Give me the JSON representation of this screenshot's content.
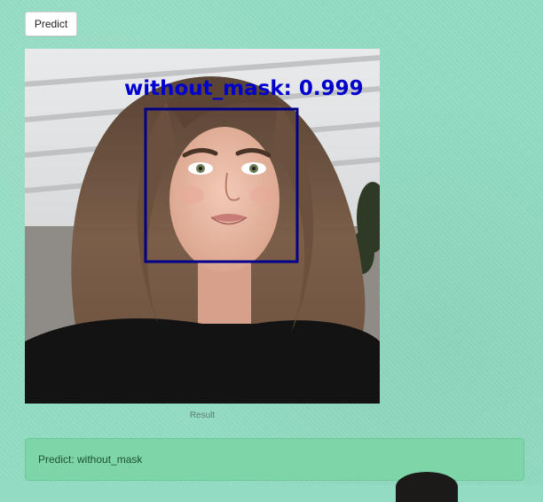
{
  "toolbar": {
    "predict_label": "Predict"
  },
  "result_image": {
    "detection_label": "without_mask: 0.999",
    "box_color": "#00008b",
    "label_color": "#0000cd",
    "caption": "Result"
  },
  "prediction_alert": {
    "text": "Predict: without_mask",
    "background_color": "#7ed6a8"
  },
  "theme": {
    "page_background": "#93dcc3"
  }
}
